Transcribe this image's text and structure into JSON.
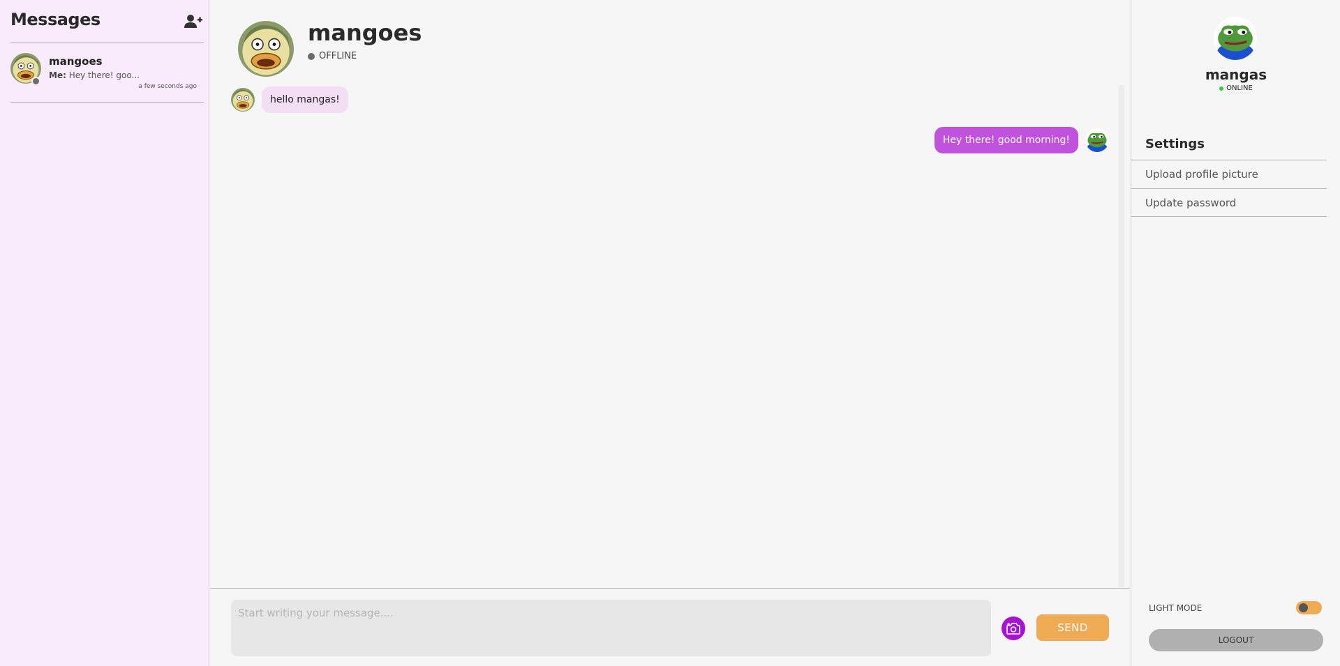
{
  "sidebar": {
    "title": "Messages",
    "conversations": [
      {
        "name": "mangoes",
        "preview_prefix": "Me:",
        "preview": "Hey there! goo...",
        "time": "a few seconds ago"
      }
    ]
  },
  "chat": {
    "contact_name": "mangoes",
    "contact_status": "OFFLINE",
    "messages": [
      {
        "direction": "in",
        "text": "hello mangas!"
      },
      {
        "direction": "out",
        "text": "Hey there! good morning!"
      }
    ],
    "input_placeholder": "Start writing your message....",
    "send_label": "SEND"
  },
  "profile": {
    "name": "mangas",
    "status": "ONLINE",
    "settings_title": "Settings",
    "settings_items": [
      "Upload profile picture",
      "Update password"
    ],
    "mode_label": "LIGHT MODE",
    "logout_label": "LOGOUT"
  },
  "colors": {
    "accent": "#c052dd",
    "send": "#efab53",
    "online": "#2ecc40",
    "offline": "#6b6b6b",
    "sidebar_bg": "#f9ebfb"
  },
  "icons": {
    "add_user": "add-user-icon",
    "camera": "camera-icon"
  }
}
